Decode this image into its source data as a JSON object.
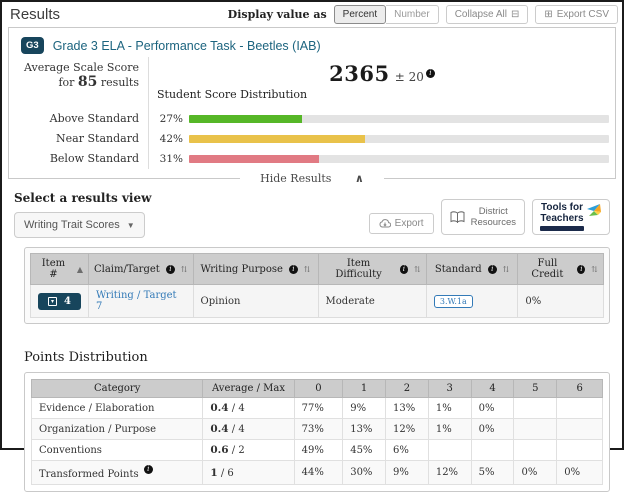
{
  "header": {
    "title": "Results",
    "display_value_label": "Display value as",
    "percent_label": "Percent",
    "number_label": "Number",
    "collapse_all_label": "Collapse All",
    "export_csv_label": "Export CSV"
  },
  "assessment": {
    "grade_badge": "G3",
    "title": "Grade 3 ELA - Performance Task - Beetles (IAB)",
    "avg_line1": "Average Scale Score",
    "avg_line2_prefix": "for",
    "result_count": "85",
    "avg_line2_suffix": "results",
    "scale_score": "2365",
    "error_band": "± 20",
    "distribution_title": "Student Score Distribution",
    "distribution": [
      {
        "label": "Above Standard",
        "pct": "27%",
        "value": 27,
        "color": "#56b727"
      },
      {
        "label": "Near Standard",
        "pct": "42%",
        "value": 42,
        "color": "#e9c24a"
      },
      {
        "label": "Below Standard",
        "pct": "31%",
        "value": 31,
        "color": "#e17a83"
      }
    ],
    "hide_results_label": "Hide Results"
  },
  "results_view": {
    "section_label": "Select a results view",
    "dropdown_value": "Writing Trait Scores",
    "export_label": "Export",
    "district_resources_line1": "District",
    "district_resources_line2": "Resources",
    "tft_line1": "Tools for",
    "tft_line2": "Teachers"
  },
  "item_table": {
    "columns": [
      "Item #",
      "Claim/Target",
      "Writing Purpose",
      "Item Difficulty",
      "Standard",
      "Full Credit"
    ],
    "row": {
      "item_number": "4",
      "claim": "Writing",
      "separator": "/",
      "target": "Target 7",
      "writing_purpose": "Opinion",
      "item_difficulty": "Moderate",
      "standard": "3.W.1a",
      "full_credit": "0%"
    }
  },
  "points_distribution": {
    "title": "Points Distribution",
    "columns": [
      "Category",
      "Average / Max",
      "0",
      "1",
      "2",
      "3",
      "4",
      "5",
      "6"
    ],
    "separator": "/",
    "rows": [
      {
        "category": "Evidence / Elaboration",
        "average": "0.4",
        "max": "4",
        "points": [
          "77%",
          "9%",
          "13%",
          "1%",
          "0%",
          "",
          ""
        ]
      },
      {
        "category": "Organization / Purpose",
        "average": "0.4",
        "max": "4",
        "points": [
          "73%",
          "13%",
          "12%",
          "1%",
          "0%",
          "",
          ""
        ]
      },
      {
        "category": "Conventions",
        "average": "0.6",
        "max": "2",
        "points": [
          "49%",
          "45%",
          "6%",
          "",
          "",
          "",
          ""
        ]
      },
      {
        "category": "Transformed Points",
        "average": "1",
        "max": "6",
        "points": [
          "44%",
          "30%",
          "9%",
          "12%",
          "5%",
          "0%",
          "0%"
        ]
      }
    ]
  }
}
